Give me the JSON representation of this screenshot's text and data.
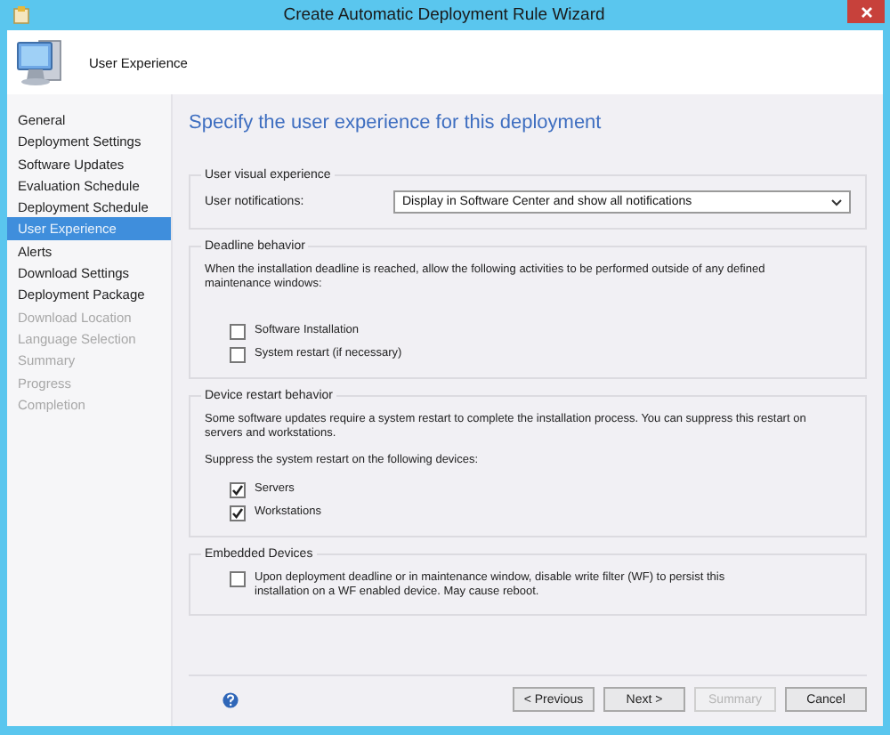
{
  "window": {
    "title": "Create Automatic Deployment Rule Wizard"
  },
  "header": {
    "title": "User Experience"
  },
  "sidebar": {
    "items": [
      {
        "label": "General",
        "selected": false,
        "disabled": false
      },
      {
        "label": "Deployment Settings",
        "selected": false,
        "disabled": false
      },
      {
        "label": "Software Updates",
        "selected": false,
        "disabled": false
      },
      {
        "label": "Evaluation Schedule",
        "selected": false,
        "disabled": false
      },
      {
        "label": "Deployment Schedule",
        "selected": false,
        "disabled": false
      },
      {
        "label": "User Experience",
        "selected": true,
        "disabled": false
      },
      {
        "label": "Alerts",
        "selected": false,
        "disabled": false
      },
      {
        "label": "Download Settings",
        "selected": false,
        "disabled": false
      },
      {
        "label": "Deployment Package",
        "selected": false,
        "disabled": false
      },
      {
        "label": "Download Location",
        "selected": false,
        "disabled": true
      },
      {
        "label": "Language Selection",
        "selected": false,
        "disabled": true
      },
      {
        "label": "Summary",
        "selected": false,
        "disabled": true
      },
      {
        "label": "Progress",
        "selected": false,
        "disabled": true
      },
      {
        "label": "Completion",
        "selected": false,
        "disabled": true
      }
    ]
  },
  "page_title": "Specify the user experience for this deployment",
  "sections": [
    {
      "title": "User visual experience",
      "items": [
        {
          "kind": "dropdown",
          "label": "User notifications:",
          "value": "Display in Software Center and show all notifications"
        }
      ]
    },
    {
      "title": "Deadline behavior",
      "items": [
        {
          "kind": "text",
          "text": "When the installation deadline is reached, allow the following activities to be performed outside of any defined maintenance windows:"
        },
        {
          "kind": "checkbox",
          "label": "Software Installation",
          "checked": false
        },
        {
          "kind": "checkbox",
          "label": "System restart (if necessary)",
          "checked": false
        }
      ]
    },
    {
      "title": "Device restart behavior",
      "items": [
        {
          "kind": "text",
          "text": "Some software updates require a system restart to complete the installation process. You can suppress this restart on servers and workstations."
        },
        {
          "kind": "text",
          "text": "Suppress the system restart on the following devices:"
        },
        {
          "kind": "checkbox",
          "label": "Servers",
          "checked": true
        },
        {
          "kind": "checkbox",
          "label": "Workstations",
          "checked": true
        }
      ]
    },
    {
      "title": "Embedded Devices",
      "items": [
        {
          "kind": "checkbox",
          "label": "Upon deployment deadline or in maintenance window, disable write filter (WF) to persist this installation on a WF enabled device. May cause reboot.",
          "checked": false
        }
      ]
    }
  ],
  "buttons": [
    {
      "label": "< Previous",
      "disabled": false
    },
    {
      "label": "Next >",
      "disabled": false
    },
    {
      "label": "Summary",
      "disabled": true
    },
    {
      "label": "Cancel",
      "disabled": false
    }
  ]
}
